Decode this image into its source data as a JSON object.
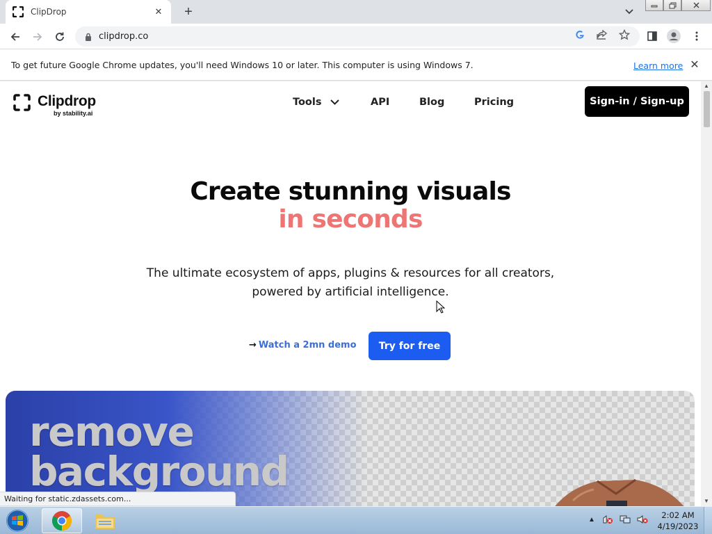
{
  "browser": {
    "tab_title": "ClipDrop",
    "tab_close": "✕",
    "new_tab": "+",
    "url": "clipdrop.co",
    "infobar_message": "To get future Google Chrome updates, you'll need Windows 10 or later. This computer is using Windows 7.",
    "infobar_link": "Learn more",
    "infobar_close": "✕",
    "status_text": "Waiting for static.zdassets.com..."
  },
  "site": {
    "logo_name": "Clipdrop",
    "logo_sub": "by stability.ai",
    "nav": [
      "Tools",
      "API",
      "Blog",
      "Pricing"
    ],
    "signin_label": "Sign-in / Sign-up"
  },
  "hero": {
    "title": "Create stunning visuals",
    "accent": "in seconds",
    "subtitle_line1": "The ultimate ecosystem of apps, plugins & resources for all creators,",
    "subtitle_line2": "powered by artificial intelligence.",
    "demo_arrow": "→",
    "demo_label": "Watch a 2mn demo",
    "cta_label": "Try for free"
  },
  "banner": {
    "line1": "remove",
    "line2": "background"
  },
  "taskbar": {
    "time": "2:02 AM",
    "date": "4/19/2023"
  },
  "colors": {
    "accent": "#ef7474",
    "cta": "#1d5cf0",
    "link": "#3b6fd8"
  }
}
